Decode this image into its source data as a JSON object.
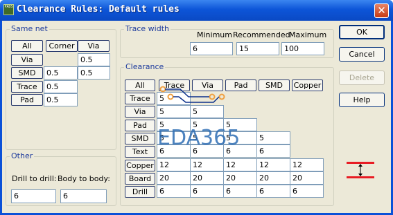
{
  "window": {
    "title": "Clearance Rules: Default rules",
    "icon_text": "PADS",
    "close_glyph": "✕"
  },
  "same_net": {
    "title": "Same net",
    "buttons": [
      "All",
      "Corner",
      "Via"
    ],
    "rows": [
      {
        "label": "Via",
        "values": [
          "",
          "0.5"
        ]
      },
      {
        "label": "SMD",
        "values": [
          "0.5",
          "0.5"
        ]
      },
      {
        "label": "Trace",
        "values": [
          "0.5"
        ]
      },
      {
        "label": "Pad",
        "values": [
          "0.5"
        ]
      }
    ]
  },
  "trace_width": {
    "title": "Trace width",
    "labels": [
      "Minimum",
      "Recommended",
      "Maximum"
    ],
    "values": [
      "6",
      "15",
      "100"
    ]
  },
  "clearance": {
    "title": "Clearance",
    "all_label": "All",
    "columns": [
      "Trace",
      "Via",
      "Pad",
      "SMD",
      "Copper"
    ],
    "rows": [
      {
        "label": "Trace",
        "values": [
          "5"
        ]
      },
      {
        "label": "Via",
        "values": [
          "5",
          "5"
        ]
      },
      {
        "label": "Pad",
        "values": [
          "5",
          "5",
          "5"
        ]
      },
      {
        "label": "SMD",
        "values": [
          "5",
          "5",
          "5",
          "5"
        ]
      },
      {
        "label": "Text",
        "values": [
          "6",
          "6",
          "6",
          "6"
        ]
      },
      {
        "label": "Copper",
        "values": [
          "12",
          "12",
          "12",
          "12",
          "12"
        ]
      },
      {
        "label": "Board",
        "values": [
          "20",
          "20",
          "20",
          "20",
          "20"
        ]
      },
      {
        "label": "Drill",
        "values": [
          "6",
          "6",
          "6",
          "6",
          "6"
        ]
      }
    ]
  },
  "other": {
    "title": "Other",
    "labels": [
      "Drill to drill:",
      "Body to body:"
    ],
    "values": [
      "6",
      "6"
    ]
  },
  "dialog_buttons": {
    "ok": "OK",
    "cancel": "Cancel",
    "delete": "Delete",
    "help": "Help"
  },
  "watermark": "EDA365",
  "colors": {
    "title_bar": "#0d55d8",
    "dialog_bg": "#ece9d8",
    "group_title": "#1c3a9c",
    "watermark": "#2e6eb5",
    "clearance_icon": "#e81c24",
    "trace_overlay": "#f0a040"
  }
}
